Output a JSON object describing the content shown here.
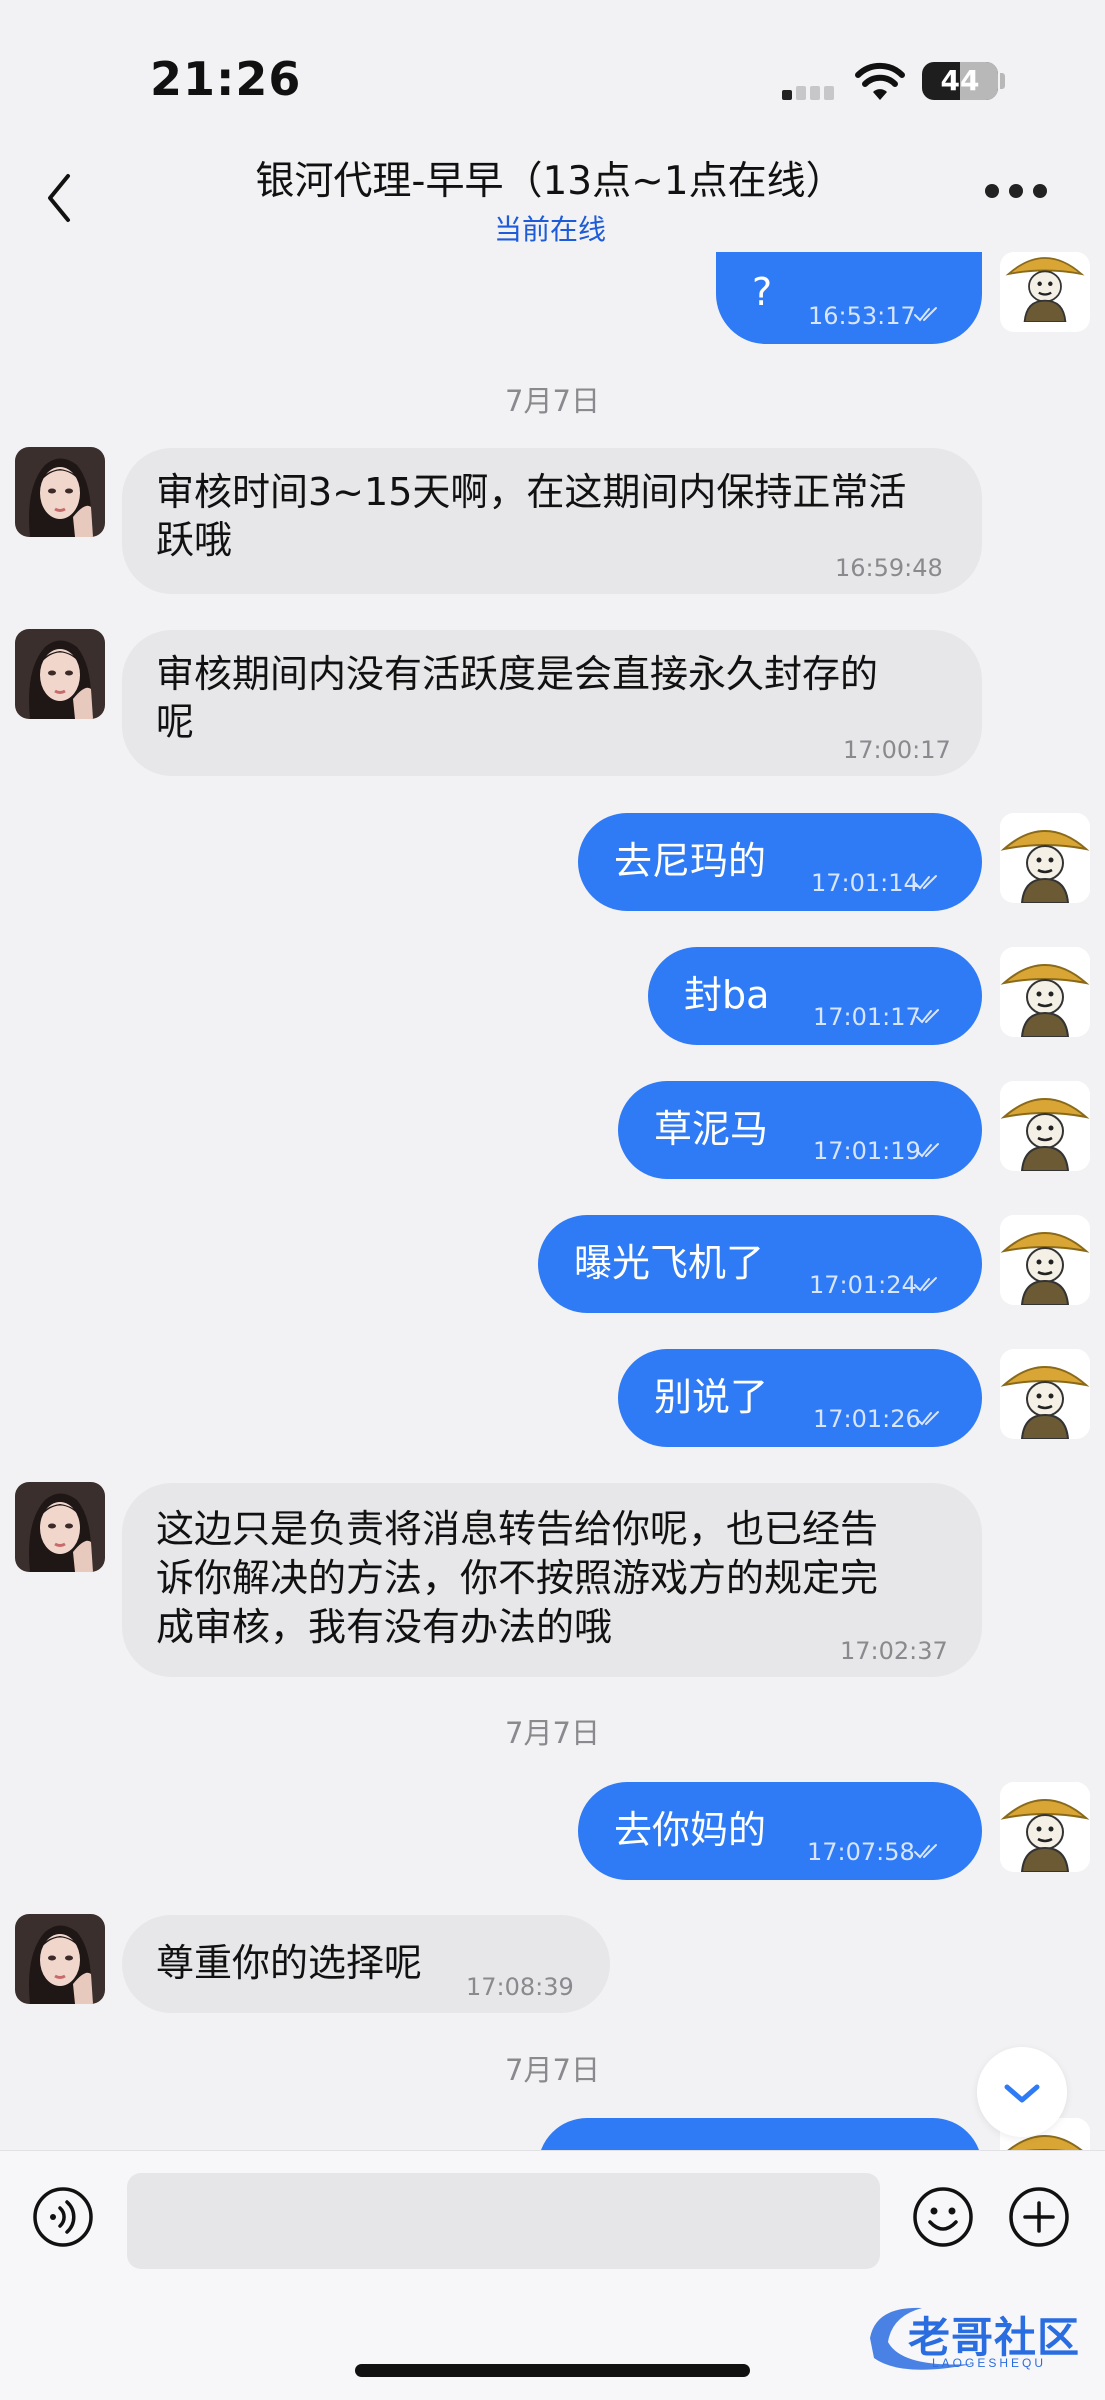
{
  "status_bar": {
    "time": "21:26",
    "battery": "44"
  },
  "header": {
    "title": "银河代理-早早（13点~1点在线）",
    "subtitle": "当前在线"
  },
  "messages": [
    {
      "side": "out",
      "text": "?",
      "time": "16:53:17",
      "status": "read"
    },
    {
      "type": "date",
      "text": "7月7日"
    },
    {
      "side": "in",
      "line1": "审核时间3~15天啊，在这期间内保持正常活",
      "line2": "跃哦",
      "time": "16:59:48"
    },
    {
      "side": "in",
      "line1": "审核期间内没有活跃度是会直接永久封存的",
      "line2": "呢",
      "time": "17:00:17"
    },
    {
      "side": "out",
      "text": "去尼玛的",
      "time": "17:01:14",
      "status": "read"
    },
    {
      "side": "out",
      "text": "封ba",
      "time": "17:01:17",
      "status": "read"
    },
    {
      "side": "out",
      "text": "草泥马",
      "time": "17:01:19",
      "status": "read"
    },
    {
      "side": "out",
      "text": "曝光飞机了",
      "time": "17:01:24",
      "status": "read"
    },
    {
      "side": "out",
      "text": "别说了",
      "time": "17:01:26",
      "status": "read"
    },
    {
      "side": "in",
      "line1": "这边只是负责将消息转告给你呢，也已经告",
      "line2": "诉你解决的方法，你不按照游戏方的规定完",
      "line3": "成审核，我有没有办法的哦",
      "time": "17:02:37"
    },
    {
      "type": "date",
      "text": "7月7日"
    },
    {
      "side": "out",
      "text": "去你妈的",
      "time": "17:07:58",
      "status": "read"
    },
    {
      "side": "in",
      "text": "尊重你的选择呢",
      "time": "17:08:39"
    },
    {
      "type": "date",
      "text": "7月7日"
    }
  ],
  "input": {
    "placeholder": ""
  },
  "watermark": {
    "text": "老哥社区",
    "sub": "LAOGESHEQU"
  },
  "colors": {
    "outgoing": "#2f7af5",
    "incoming": "#e7e7e9",
    "link": "#1d5bd8",
    "background": "#f2f2f4"
  },
  "icons": [
    "back-chevron-icon",
    "more-dots-icon",
    "read-check-icon",
    "voice-icon",
    "emoji-icon",
    "plus-icon",
    "chevron-down-icon",
    "wifi-icon",
    "signal-icon",
    "battery-icon"
  ]
}
